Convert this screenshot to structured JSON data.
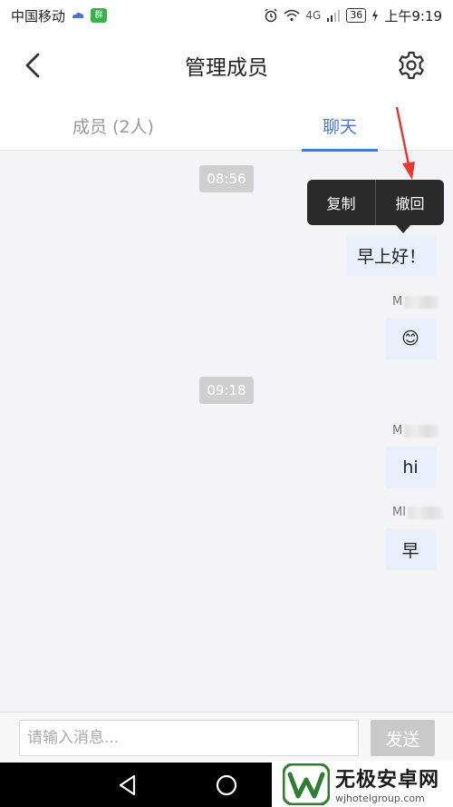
{
  "status_bar": {
    "carrier": "中国移动",
    "app_badge": "群",
    "network": "4G",
    "battery": "36",
    "time": "上午9:19"
  },
  "header": {
    "title": "管理成员",
    "back_icon": "chevron-left-icon",
    "settings_icon": "gear-icon"
  },
  "tabs": [
    {
      "label": "成员 (2人)",
      "active": false
    },
    {
      "label": "聊天",
      "active": true
    }
  ],
  "chat": {
    "accent_color": "#4a78c8",
    "bubble_color": "#e8f0fb",
    "timestamps": [
      "08:56",
      "09:18"
    ],
    "messages": [
      {
        "sender": "",
        "text": "早上好！"
      },
      {
        "sender": "M",
        "text": "😊"
      },
      {
        "sender": "M",
        "text": "hi"
      },
      {
        "sender": "MI",
        "text": "早"
      }
    ],
    "context_menu": [
      "复制",
      "撤回"
    ]
  },
  "input_bar": {
    "placeholder": "请输入消息...",
    "value": "",
    "send_label": "发送"
  },
  "watermark": {
    "title": "无极安卓网",
    "url": "wjhotelgroup.com"
  }
}
